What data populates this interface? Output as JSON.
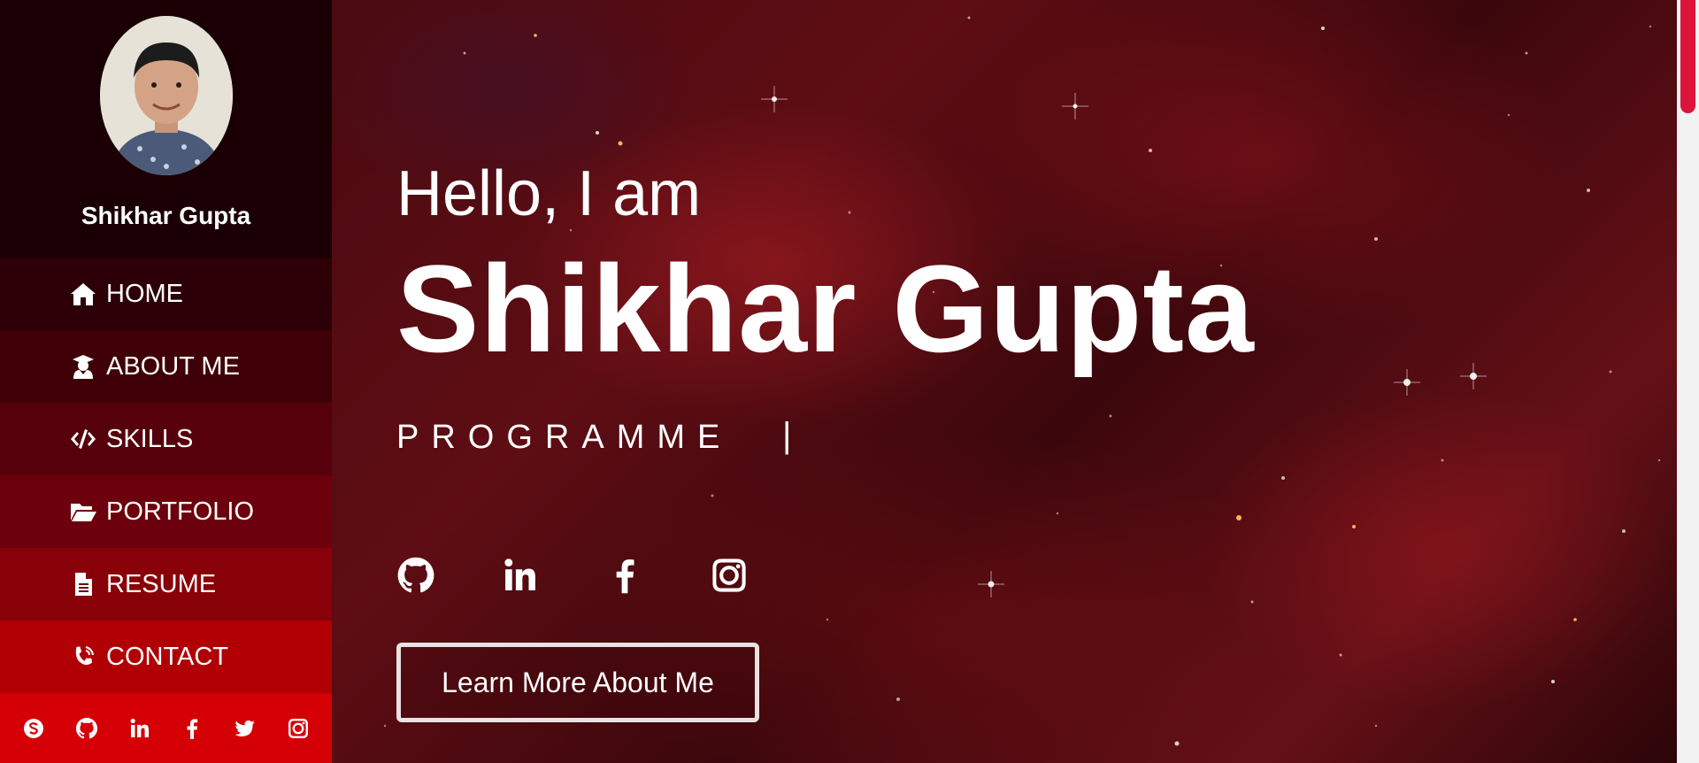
{
  "sidebar": {
    "profile_name": "Shikhar Gupta",
    "nav": [
      {
        "label": "HOME",
        "icon": "home-icon"
      },
      {
        "label": "ABOUT ME",
        "icon": "user-graduate-icon"
      },
      {
        "label": "SKILLS",
        "icon": "code-icon"
      },
      {
        "label": "PORTFOLIO",
        "icon": "folder-open-icon"
      },
      {
        "label": "RESUME",
        "icon": "file-icon"
      },
      {
        "label": "CONTACT",
        "icon": "phone-icon"
      }
    ],
    "social_icons": [
      "skype-icon",
      "github-icon",
      "linkedin-icon",
      "facebook-icon",
      "twitter-icon",
      "instagram-icon"
    ]
  },
  "hero": {
    "greeting": "Hello, I am",
    "name": "Shikhar Gupta",
    "role": "PROGRAMME",
    "cursor": "|",
    "social_icons": [
      "github-icon",
      "linkedin-icon",
      "facebook-icon",
      "instagram-icon"
    ],
    "cta_label": "Learn More About Me"
  },
  "colors": {
    "sidebar_top": "#1a0004",
    "sidebar_accent": "#d40006",
    "scroll_thumb": "#dc143c",
    "text": "#ffffff"
  }
}
